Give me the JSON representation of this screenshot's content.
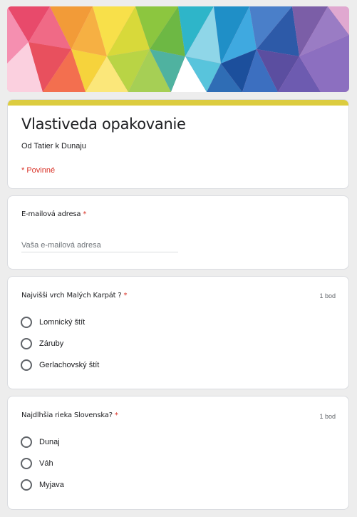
{
  "header": {
    "colors": [
      "#e84a6b",
      "#f29b38",
      "#f6d33c",
      "#8cc63f",
      "#2eb5c9",
      "#2f6db5",
      "#7b5ea7",
      "#f4a8c8",
      "#ffffff"
    ]
  },
  "form": {
    "title": "Vlastiveda opakovanie",
    "description": "Od Tatier k Dunaju",
    "required_note": "* Povinné",
    "accent_color": "#dccc3f"
  },
  "email": {
    "label": "E-mailová adresa",
    "required_star": "*",
    "placeholder": "Vaša e-mailová adresa",
    "value": ""
  },
  "questions": [
    {
      "title": "Najvišši vrch Malých Karpát ?",
      "required_star": "*",
      "points": "1 bod",
      "options": [
        "Lomnický štít",
        "Záruby",
        "Gerlachovský štít"
      ]
    },
    {
      "title": "Najdlhšia rieka Slovenska?",
      "required_star": "*",
      "points": "1 bod",
      "options": [
        "Dunaj",
        "Váh",
        "Myjava"
      ]
    }
  ]
}
